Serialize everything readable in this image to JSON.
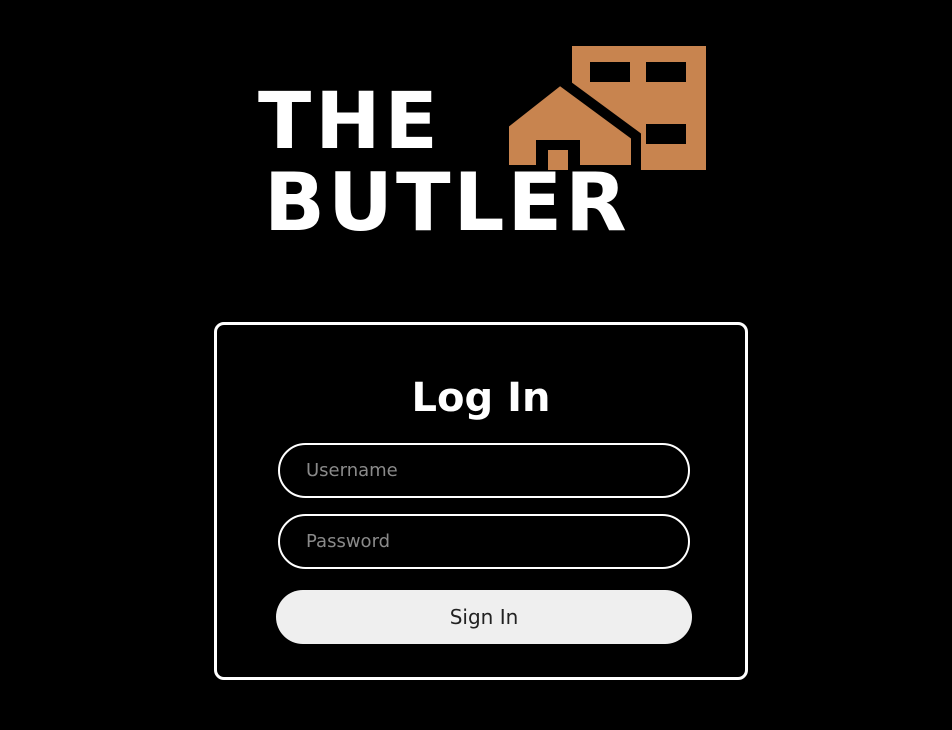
{
  "logo": {
    "line1": "THE",
    "line2": "BUTLER",
    "accent_color": "#c8844f",
    "icon": "house-building-icon"
  },
  "login_form": {
    "title": "Log In",
    "username_placeholder": "Username",
    "username_value": "",
    "password_placeholder": "Password",
    "password_value": "",
    "submit_label": "Sign In"
  },
  "colors": {
    "background": "#000000",
    "foreground": "#ffffff",
    "button_bg": "#efefef",
    "placeholder": "#8a8a8a"
  }
}
